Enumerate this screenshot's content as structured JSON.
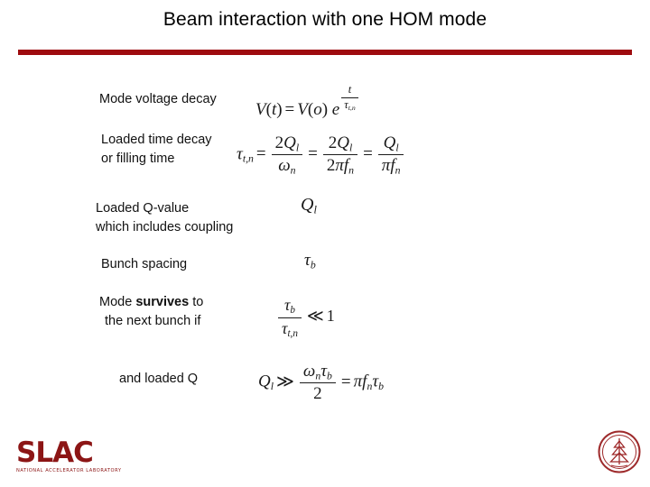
{
  "slide": {
    "title": "Beam interaction with one HOM mode",
    "accent_color": "#9e0b0f",
    "background_color": "#ffffff",
    "rows": [
      {
        "label_line1": "Mode voltage decay",
        "label_line2": "",
        "formula_text": "V(t) = V(o) e^( t / tau_t,n )"
      },
      {
        "label_line1": "Loaded time decay",
        "label_line2": "or filling time",
        "formula_text": "tau_t,n = 2Q_l / omega_n = 2Q_l / (2 pi f_n) = Q_l / (pi f_n)"
      },
      {
        "label_line1": "Loaded Q-value",
        "label_line2": "which includes coupling",
        "formula_text": "Q_l"
      },
      {
        "label_line1": "Bunch spacing",
        "label_line2": "",
        "formula_text": "tau_b"
      },
      {
        "label_line1_pre": "Mode ",
        "label_line1_bold": "survives",
        "label_line1_post": " to",
        "label_line2": "the next bunch if",
        "formula_text": "tau_b / tau_t,n << 1"
      },
      {
        "label_line1": "and loaded Q",
        "label_line2": "",
        "formula_text": "Q_l >> omega_n tau_b / 2 = pi f_n tau_b"
      }
    ],
    "math_symbols": {
      "V": "V",
      "t": "t",
      "o": "o",
      "e": "e",
      "tau": "τ",
      "omega": "ω",
      "pi": "π",
      "Q": "Q",
      "f": "f",
      "sub_t": "t",
      "sub_n": "n",
      "sub_l": "l",
      "sub_b": "b",
      "sub_tn": "t,n",
      "eq": "=",
      "much_less": "≪",
      "much_greater": "≫",
      "two": "2",
      "one": "1"
    }
  },
  "logo": {
    "wordmark": "SLAC",
    "tagline": "NATIONAL ACCELERATOR LABORATORY",
    "color": "#8c1515"
  },
  "seal": {
    "name": "stanford-seal",
    "color": "#9e2a2b"
  }
}
